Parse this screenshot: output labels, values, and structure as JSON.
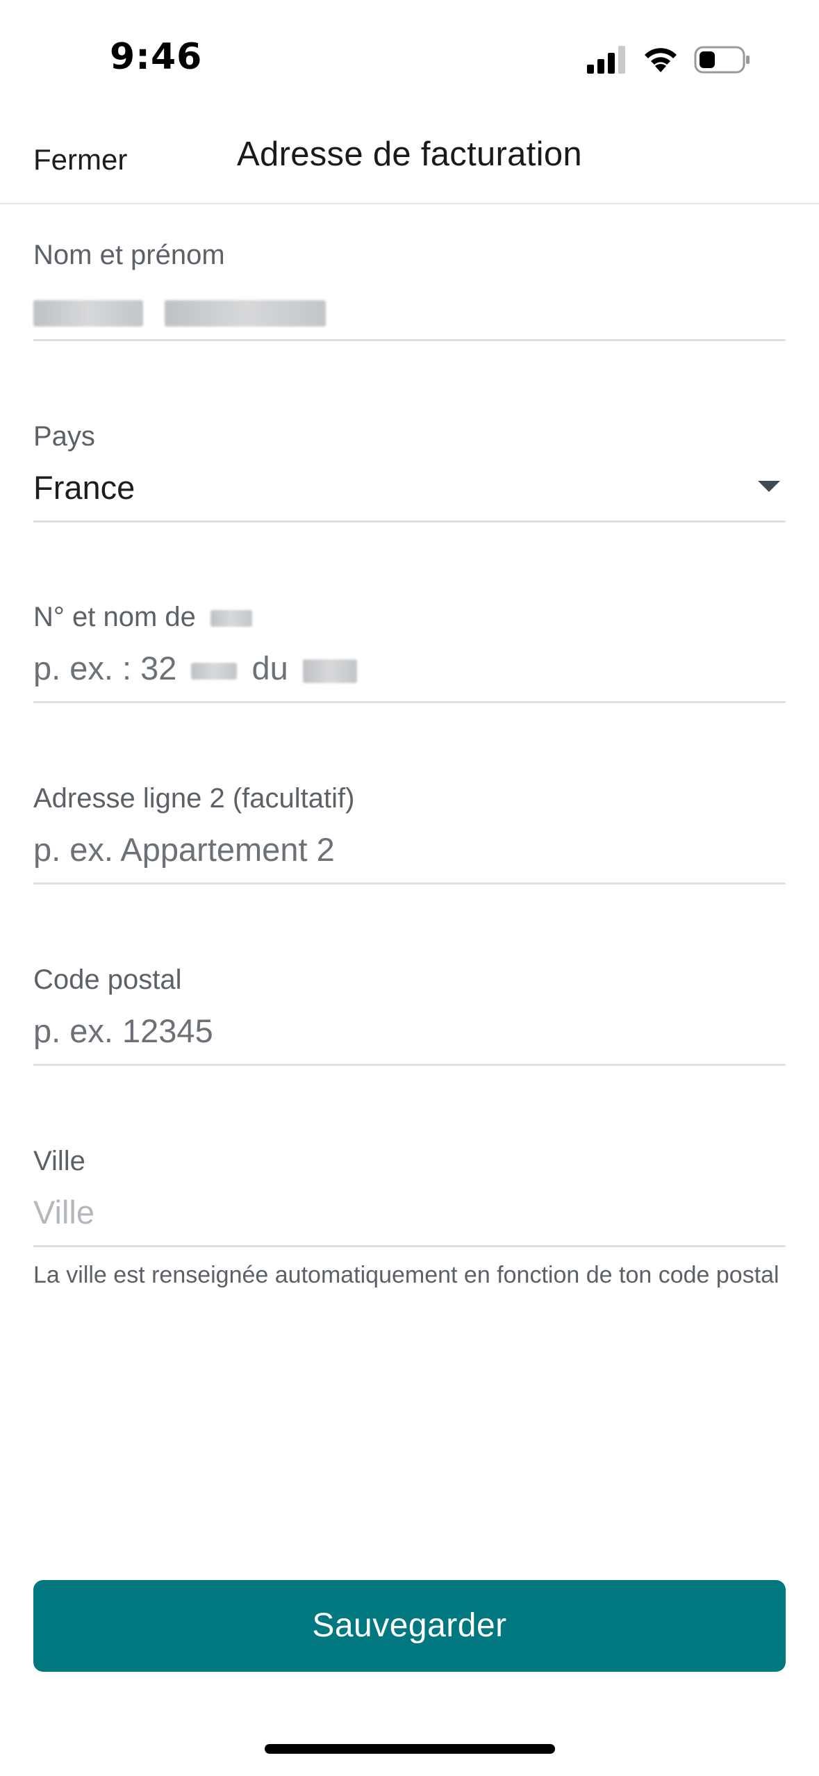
{
  "status_bar": {
    "time": "9:46",
    "icons": [
      "signal-icon",
      "wifi-icon",
      "battery-icon"
    ]
  },
  "header": {
    "close_label": "Fermer",
    "title": "Adresse de facturation"
  },
  "form": {
    "name": {
      "label": "Nom et prénom",
      "value": "[redacted]"
    },
    "country": {
      "label": "Pays",
      "value": "France",
      "icon": "chevron-down-icon"
    },
    "street": {
      "label_prefix": "N° et nom de",
      "placeholder_prefix": "p. ex. : 32",
      "placeholder_mid": "du"
    },
    "address2": {
      "label": "Adresse ligne 2 (facultatif)",
      "placeholder": "p. ex. Appartement 2"
    },
    "postal_code": {
      "label": "Code postal",
      "placeholder": "p. ex. 12345"
    },
    "city": {
      "label": "Ville",
      "placeholder": "Ville",
      "helper": "La ville est renseignée automatiquement en fonction de ton code postal"
    }
  },
  "actions": {
    "save_label": "Sauvegarder"
  },
  "colors": {
    "primary": "#017880",
    "divider": "#dfe1e3",
    "label": "#5b6167"
  }
}
